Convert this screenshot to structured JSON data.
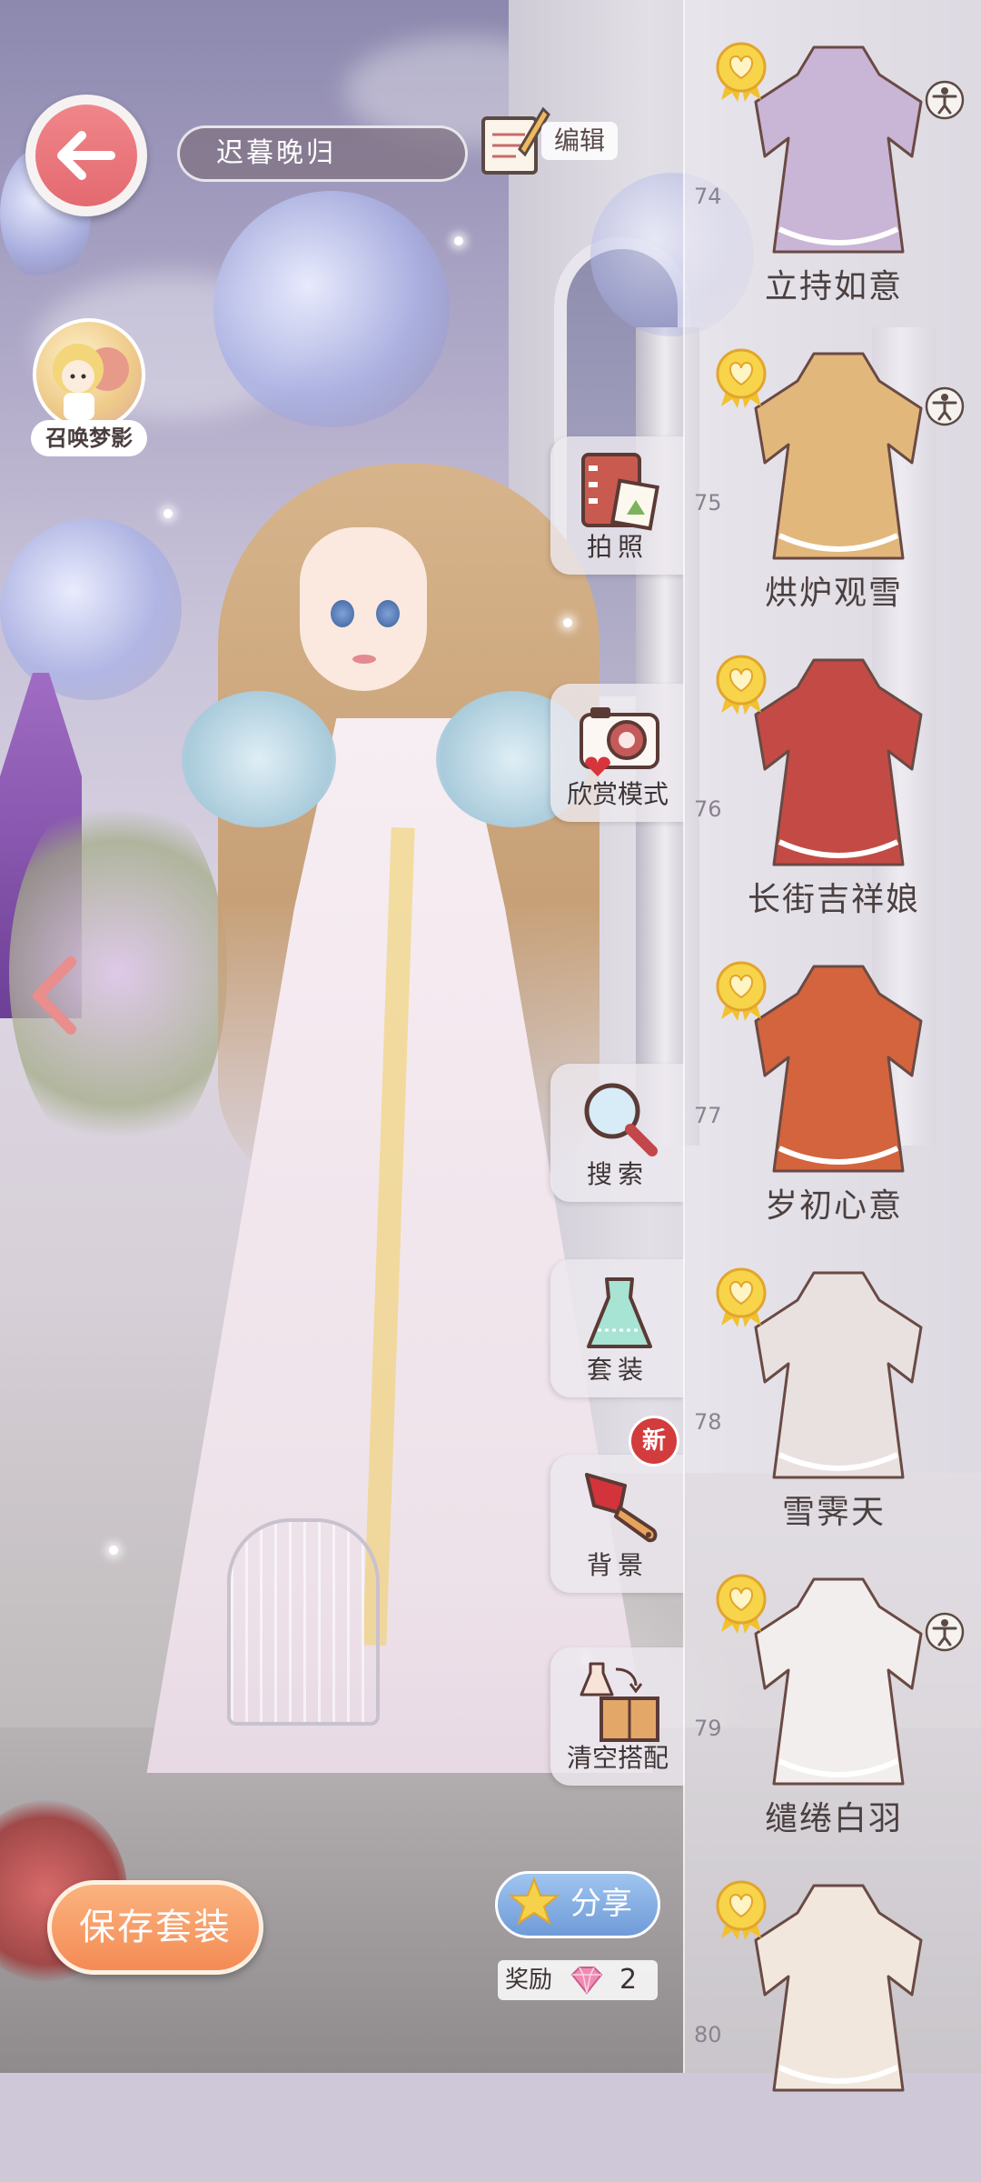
{
  "header": {
    "outfit_name": "迟暮晚归",
    "edit_label": "编辑"
  },
  "summon": {
    "label": "召唤梦影"
  },
  "tools": [
    {
      "id": "photo",
      "label": "拍照",
      "icon": "photo-album-icon"
    },
    {
      "id": "appreciate",
      "label": "欣赏模式",
      "icon": "camera-icon"
    },
    {
      "id": "search",
      "label": "搜索",
      "icon": "magnifier-icon"
    },
    {
      "id": "suit",
      "label": "套装",
      "icon": "dress-icon"
    },
    {
      "id": "background",
      "label": "背景",
      "icon": "paint-brush-icon",
      "badge": "新"
    },
    {
      "id": "clear",
      "label": "清空搭配",
      "icon": "dress-to-box-icon"
    }
  ],
  "outfits": [
    {
      "number": "74",
      "name": "立持如意",
      "favorited": true,
      "has_pose": true,
      "color": "#c9b5d6"
    },
    {
      "number": "75",
      "name": "烘炉观雪",
      "favorited": true,
      "has_pose": true,
      "color": "#e2b77b"
    },
    {
      "number": "76",
      "name": "长街吉祥娘",
      "favorited": true,
      "has_pose": false,
      "color": "#c44b45"
    },
    {
      "number": "77",
      "name": "岁初心意",
      "favorited": true,
      "has_pose": false,
      "color": "#d3643d"
    },
    {
      "number": "78",
      "name": "雪霁天",
      "favorited": true,
      "has_pose": false,
      "color": "#e9e1df"
    },
    {
      "number": "79",
      "name": "缱绻白羽",
      "favorited": true,
      "has_pose": true,
      "color": "#f3eeee"
    },
    {
      "number": "80",
      "name": "",
      "favorited": true,
      "has_pose": false,
      "color": "#f1e7dd"
    }
  ],
  "footer": {
    "save_label": "保存套装",
    "share_label": "分享",
    "reward_label": "奖励",
    "reward_count": "2"
  },
  "colors": {
    "back_button": "#e36a70",
    "save_button": "#f48b55",
    "share_button": "#6f9bd8",
    "heart_badge": "#f2c12e",
    "new_badge": "#d33c3c"
  }
}
